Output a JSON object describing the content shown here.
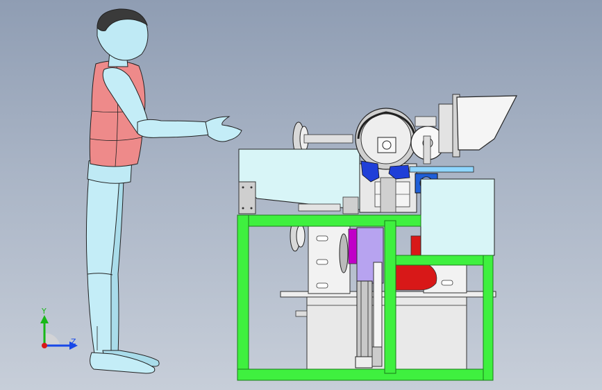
{
  "viewport": {
    "background_top": "#8f9db3",
    "background_bottom": "#c7ced9"
  },
  "figure": {
    "skin_color": "#bfeaf5",
    "vest_color": "#ee8a8a",
    "hair_color": "#3a3a3a"
  },
  "machine": {
    "frame_color": "#3ff03f",
    "panel_color": "#d8f5f7",
    "accent_blue": "#1f3fd8",
    "accent_purple": "#b7a3f0",
    "accent_magenta": "#c000c8",
    "accent_red": "#d81818",
    "grey_body": "#e6e6e6"
  },
  "triad": {
    "y_label": "Y",
    "z_label": "Z",
    "y_color": "#18b818",
    "z_color": "#1848e8",
    "origin_color": "#d81818"
  }
}
